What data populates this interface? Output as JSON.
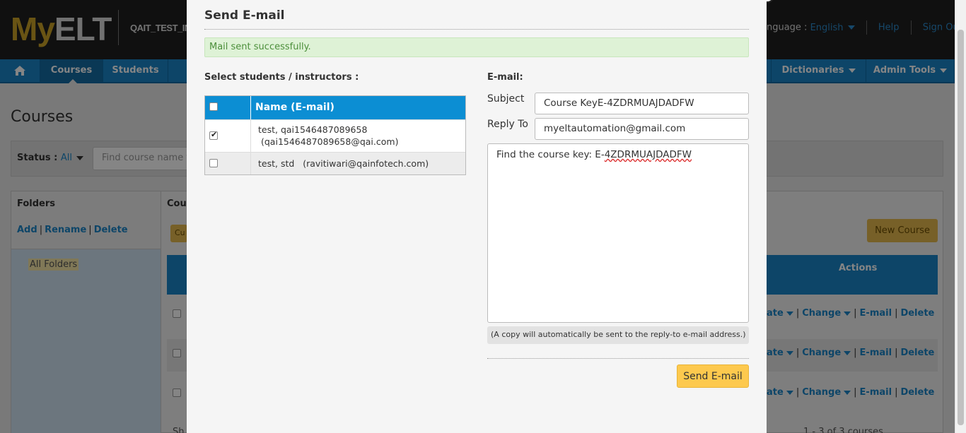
{
  "app": {
    "logo_my": "My",
    "logo_elt": "ELT",
    "institution": "QAIT_TEST_IN",
    "language_label": "anguage :",
    "language_value": "English",
    "help": "Help",
    "sign_out": "Sign Out"
  },
  "nav": {
    "courses": "Courses",
    "students": "Students",
    "dictionaries": "Dictionaries",
    "admin_tools": "Admin Tools"
  },
  "page": {
    "title": "Courses",
    "status_label": "Status :",
    "status_value": "All",
    "find_placeholder": "Find course name t",
    "folders_title": "Folders",
    "folder_add": "Add",
    "folder_rename": "Rename",
    "folder_delete": "Delete",
    "all_folders": "All Folders",
    "courses_col": "Cour",
    "cur_btn": "Cu",
    "new_course": "New Course",
    "actions_header": "Actions",
    "row_actions": {
      "ate": "ate",
      "change": "Change",
      "email": "E-mail",
      "delete": "Delete"
    },
    "pager": "1 - 3 of 3 courses",
    "sh": "Sh"
  },
  "modal": {
    "title": "Send E-mail",
    "success_message": "Mail sent successfully.",
    "select_label": "Select students / instructors :",
    "table_header": "Name  (E-mail)",
    "students": [
      {
        "name": "test, qai1546487089658",
        "email": "(qai1546487089658@qai.com)",
        "checked": true
      },
      {
        "name": "test, std",
        "email": "(ravitiwari@qainfotech.com)",
        "checked": false
      }
    ],
    "email_label": "E-mail:",
    "subject_label": "Subject",
    "subject_value": "Course KeyE-4ZDRMUAJDADFW",
    "reply_label": "Reply To",
    "reply_value": "myeltautomation@gmail.com",
    "body_prefix": "Find the course key: E-",
    "body_key": "4ZDRMUAJDADFW",
    "copy_note": "(A copy will automatically be sent to the reply-to e-mail address.)",
    "send_button": "Send E-mail"
  },
  "colors": {
    "accent": "#1a84c7",
    "header_blue": "#0c8ed3",
    "button_yellow": "#fdc94e",
    "success_bg": "#def2d6"
  }
}
